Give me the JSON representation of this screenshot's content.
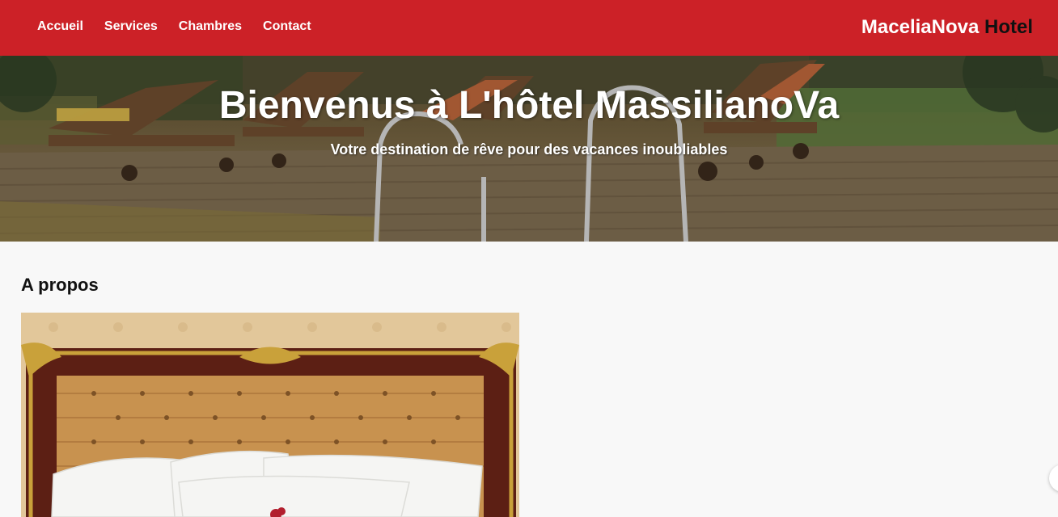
{
  "nav": {
    "links": [
      "Accueil",
      "Services",
      "Chambres",
      "Contact"
    ]
  },
  "brand": {
    "main": "MaceliaNova",
    "accent": "Hotel"
  },
  "hero": {
    "title": "Bienvenus à L'hôtel MassilianoVa",
    "subtitle": "Votre destination de rêve pour des vacances inoubliables",
    "image": "pool-deck-lounge-chairs"
  },
  "about": {
    "heading": "A propos",
    "image": "hotel-bed-headboard"
  },
  "colors": {
    "navbar": "#cc2127",
    "brand_accent": "#111111",
    "page_background": "#f8f8f8"
  }
}
